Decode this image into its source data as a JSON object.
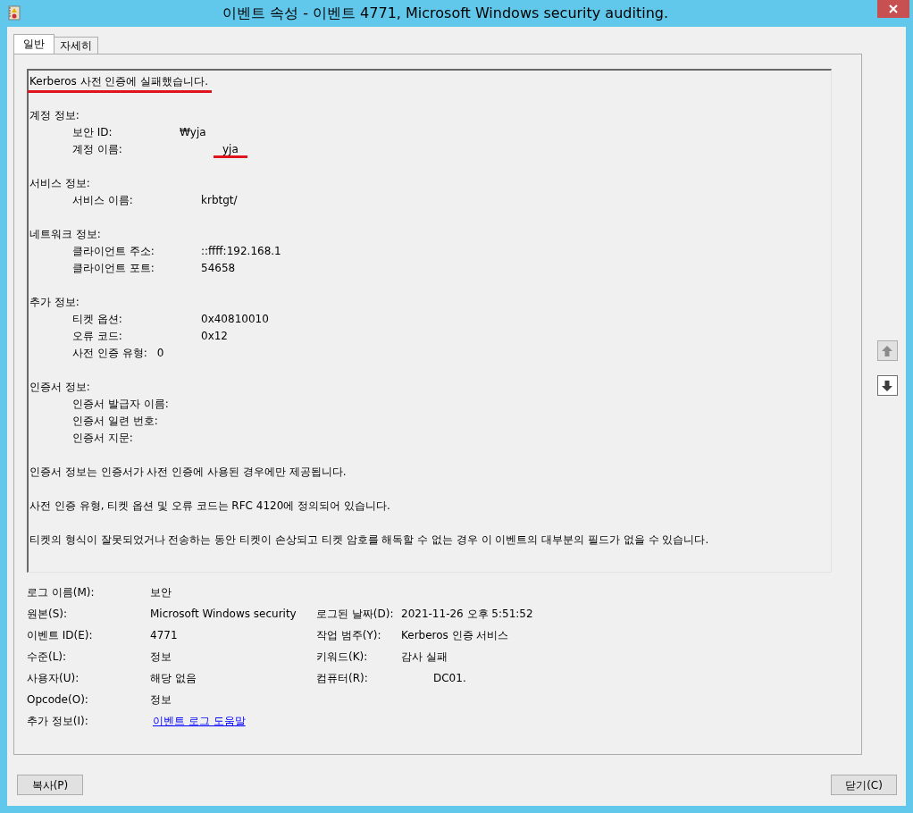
{
  "window": {
    "title": "이벤트 속성 - 이벤트 4771, Microsoft Windows security auditing."
  },
  "tabs": [
    {
      "label": "일반",
      "selected": true
    },
    {
      "label": "자세히",
      "selected": false
    }
  ],
  "description": {
    "summary": {
      "text": "Kerberos 사전 인증에 실패했습니다.",
      "annotated": true
    },
    "sections": [
      {
        "heading": "계정 정보:",
        "rows": [
          {
            "label": "보안 ID:",
            "value": "₩yja",
            "annotated": false,
            "kind": "short"
          },
          {
            "label": "계정 이름:",
            "value": "yja",
            "annotated": true,
            "kind": "long"
          }
        ]
      },
      {
        "heading": "서비스 정보:",
        "rows": [
          {
            "label": "서비스 이름:",
            "value": "krbtgt/",
            "annotated": false,
            "kind": "normal"
          }
        ]
      },
      {
        "heading": "네트워크 정보:",
        "rows": [
          {
            "label": "클라이언트 주소:",
            "value": "::ffff:192.168.1",
            "annotated": false,
            "kind": "normal"
          },
          {
            "label": "클라이언트 포트:",
            "value": "54658",
            "annotated": false,
            "kind": "normal"
          }
        ]
      },
      {
        "heading": "추가 정보:",
        "rows": [
          {
            "label": "티켓 옵션:",
            "value": "0x40810010",
            "annotated": false,
            "kind": "normal"
          },
          {
            "label": "오류 코드:",
            "value": "0x12",
            "annotated": false,
            "kind": "normal"
          },
          {
            "label": "사전 인증 유형:",
            "value": "0",
            "annotated": false,
            "kind": "tab"
          }
        ]
      },
      {
        "heading": "인증서 정보:",
        "rows": [
          {
            "label": "인증서 발급자 이름:"
          },
          {
            "label": "인증서 일련 번호:"
          },
          {
            "label": "인증서 지문:"
          }
        ]
      }
    ],
    "notes": [
      "인증서 정보는 인증서가 사전 인증에 사용된 경우에만 제공됩니다.",
      "사전 인증 유형, 티켓 옵션 및 오류 코드는 RFC 4120에 정의되어 있습니다.",
      "티켓의 형식이 잘못되었거나 전송하는 동안 티켓이 손상되고 티켓 암호를 해독할 수 없는 경우 이 이벤트의 대부분의 필드가 없을 수 있습니다."
    ]
  },
  "navigation": [
    {
      "kind": "up",
      "disabled": true
    },
    {
      "kind": "down",
      "disabled": false
    }
  ],
  "fields": [
    [
      {
        "label": "로그 이름(M):",
        "value": "보안",
        "kind": "text"
      }
    ],
    [
      {
        "label": "원본(S):",
        "value": "Microsoft Windows security",
        "kind": "text"
      },
      {
        "label": "로그된 날짜(D):",
        "value": "2021-11-26 오후 5:51:52",
        "kind": "text"
      }
    ],
    [
      {
        "label": "이벤트 ID(E):",
        "value": "4771",
        "kind": "text"
      },
      {
        "label": "작업 범주(Y):",
        "value": "Kerberos 인증 서비스",
        "kind": "text"
      }
    ],
    [
      {
        "label": "수준(L):",
        "value": "정보",
        "kind": "text"
      },
      {
        "label": "키워드(K):",
        "value": "감사 실패",
        "kind": "text"
      }
    ],
    [
      {
        "label": "사용자(U):",
        "value": "해당 없음",
        "kind": "text"
      },
      {
        "label": "컴퓨터(R):",
        "value": "DC01.",
        "kind": "indented"
      }
    ],
    [
      {
        "label": "Opcode(O):",
        "value": "정보",
        "kind": "text"
      }
    ],
    [
      {
        "label": "추가 정보(I):",
        "value": "이벤트 로그 도움말",
        "kind": "link"
      }
    ]
  ],
  "buttons": [
    "복사(P)",
    "닫기(C)"
  ]
}
